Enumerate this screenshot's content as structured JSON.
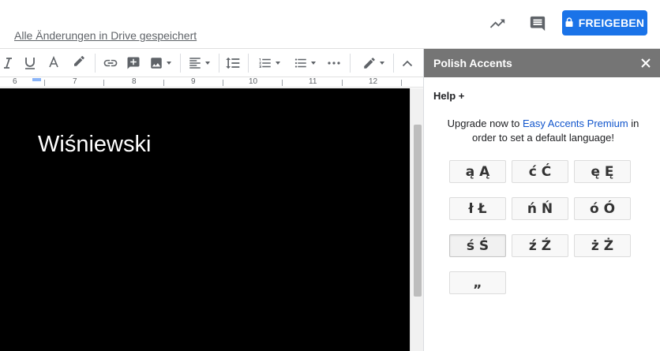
{
  "header": {
    "saved_status": "Alle Änderungen in Drive gespeichert",
    "share_label": "FREIGEBEN",
    "share_color": "#1a73e8"
  },
  "toolbar": {
    "icons": [
      "italic-icon",
      "underline-icon",
      "text-color-icon",
      "highlight-icon",
      "link-icon",
      "insert-comment-icon",
      "insert-image-icon",
      "align-icon",
      "line-spacing-icon",
      "numbered-list-icon",
      "bulleted-list-icon",
      "more-icon",
      "editing-mode-icon",
      "collapse-icon"
    ]
  },
  "ruler": {
    "numbers": [
      "6",
      "7",
      "8",
      "9",
      "10",
      "11",
      "12"
    ]
  },
  "document": {
    "text": "Wiśniewski",
    "background": "#000000"
  },
  "sidebar": {
    "title": "Polish Accents",
    "header_color": "#757575",
    "help": "Help +",
    "upgrade_before": "Upgrade now to ",
    "upgrade_link": "Easy Accents Premium",
    "upgrade_after": " in order to set a default language!",
    "keys": [
      "ą Ą",
      "ć Ć",
      "ę Ę",
      "ł Ł",
      "ń Ń",
      "ó Ó",
      "ś Ś",
      "ź Ź",
      "ż Ż",
      "„"
    ]
  }
}
